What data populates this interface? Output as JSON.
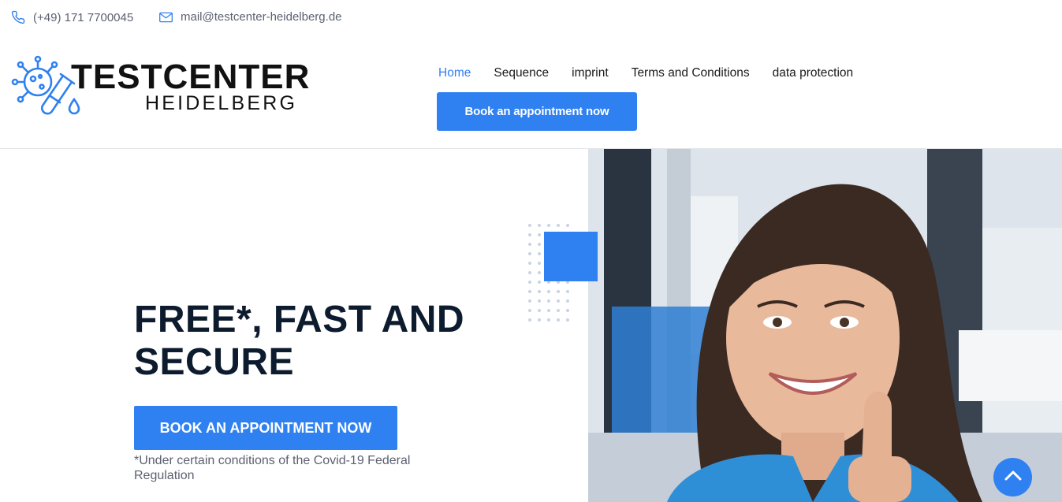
{
  "topbar": {
    "phone": "(+49) 171 7700045",
    "email": "mail@testcenter-heidelberg.de",
    "phone_icon": "phone-icon",
    "mail_icon": "mail-icon"
  },
  "logo": {
    "title": "TESTCENTER",
    "subtitle": "HEIDELBERG",
    "icon": "virus-test-tube-icon"
  },
  "nav": {
    "items": [
      {
        "label": "Home",
        "active": true
      },
      {
        "label": "Sequence",
        "active": false
      },
      {
        "label": "imprint",
        "active": false
      },
      {
        "label": "Terms and Conditions",
        "active": false
      },
      {
        "label": "data protection",
        "active": false
      }
    ],
    "book_label": "Book an appointment now"
  },
  "hero": {
    "title": "FREE*, FAST AND SECURE",
    "button_label": "BOOK AN APPOINTMENT NOW",
    "disclaimer": "*Under certain conditions of the Covid-19 Federal Regulation",
    "photo_alt": "smiling-woman-thumbs-up-photo"
  },
  "colors": {
    "accent": "#2f80f0",
    "heading": "#0d1b2e",
    "muted": "#5a6170"
  },
  "scroll_top_icon": "chevron-up-icon"
}
